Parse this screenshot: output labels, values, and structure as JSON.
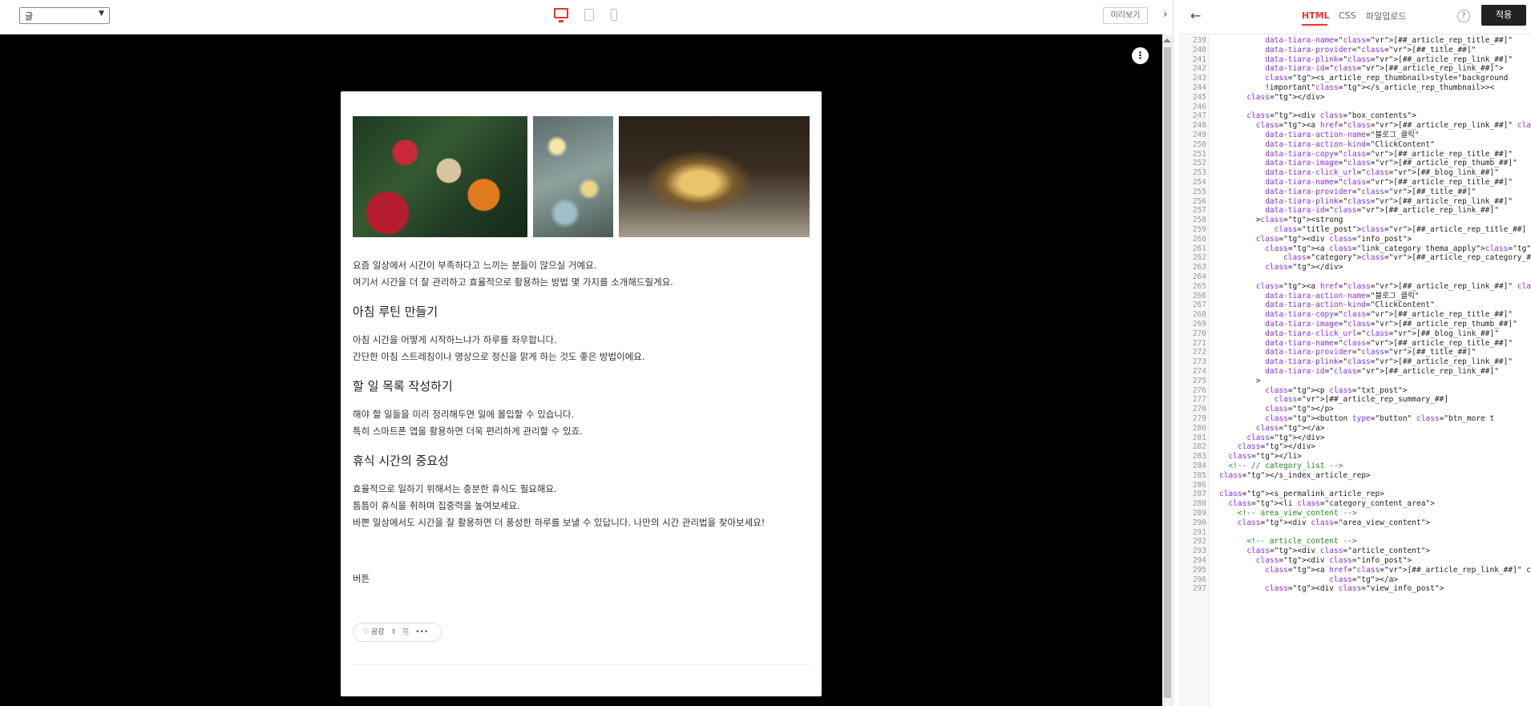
{
  "topbar": {
    "page_select": "글",
    "preview_label": "미리보기"
  },
  "article": {
    "paragraphs_intro": [
      "요즘 일상에서 시간이 부족하다고 느끼는 분들이 많으실 거예요.",
      "여기서 시간을 더 잘 관리하고 효율적으로 활용하는 방법 몇 가지를 소개해드릴게요."
    ],
    "sections": [
      {
        "heading": "아침 루틴 만들기",
        "lines": [
          "아침 시간을 어떻게 시작하느냐가 하루를 좌우합니다.",
          "간단한 아침 스트레칭이나 명상으로 정신을 맑게 하는 것도 좋은 방법이에요."
        ]
      },
      {
        "heading": "할 일 목록 작성하기",
        "lines": [
          "해야 할 일들을 미리 정리해두면 일에 몰입할 수 있습니다.",
          "특히 스마트폰 앱을 활용하면 더욱 편리하게 관리할 수 있죠."
        ]
      },
      {
        "heading": "휴식 시간의 중요성",
        "lines": [
          "효율적으로 일하기 위해서는 충분한 휴식도 필요해요.",
          "틈틈이 휴식을 취하며 집중력을 높여보세요.",
          "바쁜 일상에서도 시간을 잘 활용하면 더 풍성한 하루를 보낼 수 있답니다. 나만의 시간 관리법을 찾아보세요!"
        ]
      }
    ],
    "button_label": "버튼",
    "reactions": {
      "like_label": "♡ 공감",
      "share_glyph": "⇪",
      "copy_glyph": "⎘",
      "more_glyph": "•••"
    }
  },
  "editor": {
    "tabs": [
      {
        "label": "HTML",
        "active": true
      },
      {
        "label": "CSS",
        "active": false
      },
      {
        "label": "파일업로드",
        "active": false
      }
    ],
    "help_label": "?",
    "apply_label": "적용",
    "code_lines": [
      {
        "n": "239",
        "text": "          data-tiara-name=\"[##_article_rep_title_##]\""
      },
      {
        "n": "240",
        "text": "          data-tiara-provider=\"[##_title_##]\""
      },
      {
        "n": "241",
        "text": "          data-tiara-plink=\"[##_article_rep_link_##]\""
      },
      {
        "n": "242",
        "text": "          data-tiara-id=\"[##_article_rep_link_##]\">"
      },
      {
        "n": "243",
        "text": "          <s_article_rep_thumbnail>style=\"background"
      },
      {
        "n": "244",
        "text": "          !important\"</s_article_rep_thumbnail>><"
      },
      {
        "n": "245",
        "text": "      </div>"
      },
      {
        "n": "246",
        "text": ""
      },
      {
        "n": "247",
        "text": "      <div class=\"box_contents\">"
      },
      {
        "n": "248",
        "text": "        <a href=\"[##_article_rep_link_##]\" class="
      },
      {
        "n": "249",
        "text": "          data-tiara-action-name=\"블로그_클릭\""
      },
      {
        "n": "250",
        "text": "          data-tiara-action-kind=\"ClickContent\""
      },
      {
        "n": "251",
        "text": "          data-tiara-copy=\"[##_article_rep_title_##]\""
      },
      {
        "n": "252",
        "text": "          data-tiara-image=\"[##_article_rep_thumb_##]\""
      },
      {
        "n": "253",
        "text": "          data-tiara-click_url=\"[##_blog_link_##]\""
      },
      {
        "n": "254",
        "text": "          data-tiara-name=\"[##_article_rep_title_##]\""
      },
      {
        "n": "255",
        "text": "          data-tiara-provider=\"[##_title_##]\""
      },
      {
        "n": "256",
        "text": "          data-tiara-plink=\"[##_article_rep_link_##]\""
      },
      {
        "n": "257",
        "text": "          data-tiara-id=\"[##_article_rep_link_##]\""
      },
      {
        "n": "258",
        "text": "        ><strong"
      },
      {
        "n": "259",
        "text": "            class=\"title_post\">[##_article_rep_title_##]"
      },
      {
        "n": "260",
        "text": "        <div class=\"info_post\">"
      },
      {
        "n": "261",
        "text": "          <a class=\"link_category thema_apply\"><s"
      },
      {
        "n": "262",
        "text": "              class=\"category\">[##_article_rep_category_##]"
      },
      {
        "n": "263",
        "text": "          </div>"
      },
      {
        "n": "264",
        "text": ""
      },
      {
        "n": "265",
        "text": "        <a href=\"[##_article_rep_link_##]\" class="
      },
      {
        "n": "266",
        "text": "          data-tiara-action-name=\"블로그_클릭\""
      },
      {
        "n": "267",
        "text": "          data-tiara-action-kind=\"ClickContent\""
      },
      {
        "n": "268",
        "text": "          data-tiara-copy=\"[##_article_rep_title_##]\""
      },
      {
        "n": "269",
        "text": "          data-tiara-image=\"[##_article_rep_thumb_##]\""
      },
      {
        "n": "270",
        "text": "          data-tiara-click_url=\"[##_blog_link_##]\""
      },
      {
        "n": "271",
        "text": "          data-tiara-name=\"[##_article_rep_title_##]\""
      },
      {
        "n": "272",
        "text": "          data-tiara-provider=\"[##_title_##]\""
      },
      {
        "n": "273",
        "text": "          data-tiara-plink=\"[##_article_rep_link_##]\""
      },
      {
        "n": "274",
        "text": "          data-tiara-id=\"[##_article_rep_link_##]\""
      },
      {
        "n": "275",
        "text": "        >"
      },
      {
        "n": "276",
        "text": "          <p class=\"txt_post\">"
      },
      {
        "n": "277",
        "text": "            [##_article_rep_summary_##]"
      },
      {
        "n": "278",
        "text": "          </p>"
      },
      {
        "n": "279",
        "text": "          <button type=\"button\" class=\"btn_more t"
      },
      {
        "n": "280",
        "text": "        </a>"
      },
      {
        "n": "281",
        "text": "      </div>"
      },
      {
        "n": "282",
        "text": "    </div>"
      },
      {
        "n": "283",
        "text": "  </li>"
      },
      {
        "n": "284",
        "text": "  <!-- // category_list -->"
      },
      {
        "n": "285",
        "text": "</s_index_article_rep>"
      },
      {
        "n": "286",
        "text": ""
      },
      {
        "n": "287",
        "text": "<s_permalink_article_rep>"
      },
      {
        "n": "288",
        "text": "  <li class=\"category_content_area\">"
      },
      {
        "n": "289",
        "text": "    <!-- area_view_content -->"
      },
      {
        "n": "290",
        "text": "    <div class=\"area_view_content\">"
      },
      {
        "n": "291",
        "text": ""
      },
      {
        "n": "292",
        "text": "      <!-- article_content -->"
      },
      {
        "n": "293",
        "text": "      <div class=\"article_content\">"
      },
      {
        "n": "294",
        "text": "        <div class=\"info_post\">"
      },
      {
        "n": "295",
        "text": "          <a href=\"[##_article_rep_link_##]\" class"
      },
      {
        "n": "296",
        "text": "                        </a>"
      },
      {
        "n": "297",
        "text": "          <div class=\"view_info_post\">"
      }
    ]
  }
}
